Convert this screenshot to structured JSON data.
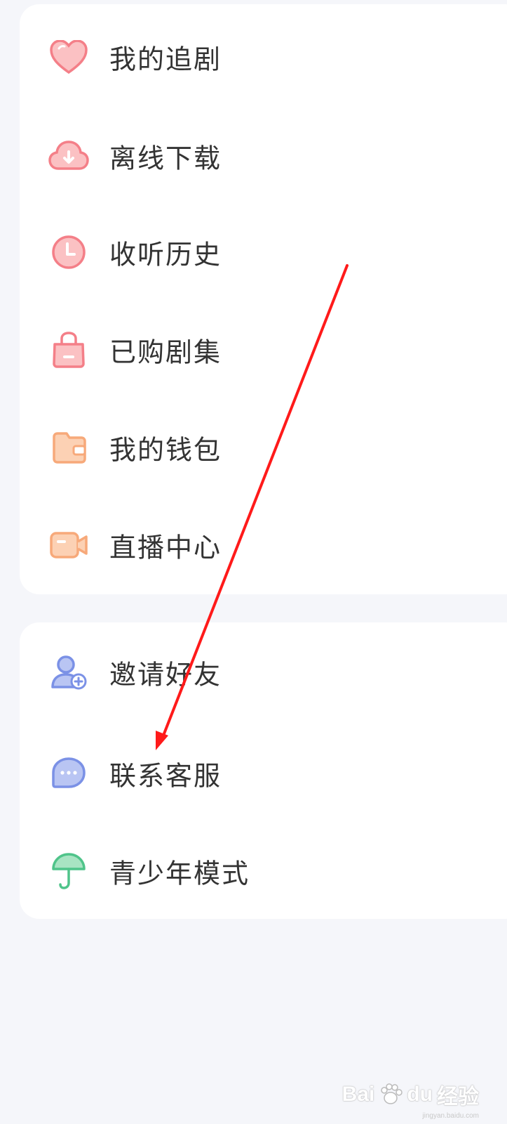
{
  "menu_group_1": {
    "items": [
      {
        "label": "我的追剧",
        "icon": "heart-icon",
        "color": "#f47f88"
      },
      {
        "label": "离线下载",
        "icon": "cloud-download-icon",
        "color": "#f47f88"
      },
      {
        "label": "收听历史",
        "icon": "clock-icon",
        "color": "#f47f88"
      },
      {
        "label": "已购剧集",
        "icon": "shopping-bag-icon",
        "color": "#f47f88"
      },
      {
        "label": "我的钱包",
        "icon": "wallet-icon",
        "color": "#f7a97a"
      },
      {
        "label": "直播中心",
        "icon": "video-camera-icon",
        "color": "#f7a97a"
      }
    ]
  },
  "menu_group_2": {
    "items": [
      {
        "label": "邀请好友",
        "icon": "add-friend-icon",
        "color": "#7b91e6"
      },
      {
        "label": "联系客服",
        "icon": "chat-bubble-icon",
        "color": "#7b91e6"
      },
      {
        "label": "青少年模式",
        "icon": "umbrella-icon",
        "color": "#4fc48a"
      }
    ]
  },
  "annotation": {
    "icon": "red-arrow-icon",
    "color": "#ff1a1a"
  },
  "watermark": {
    "brand": "Bai",
    "logo_glyph": "du",
    "suffix": "经验",
    "url": "jingyan.baidu.com"
  }
}
